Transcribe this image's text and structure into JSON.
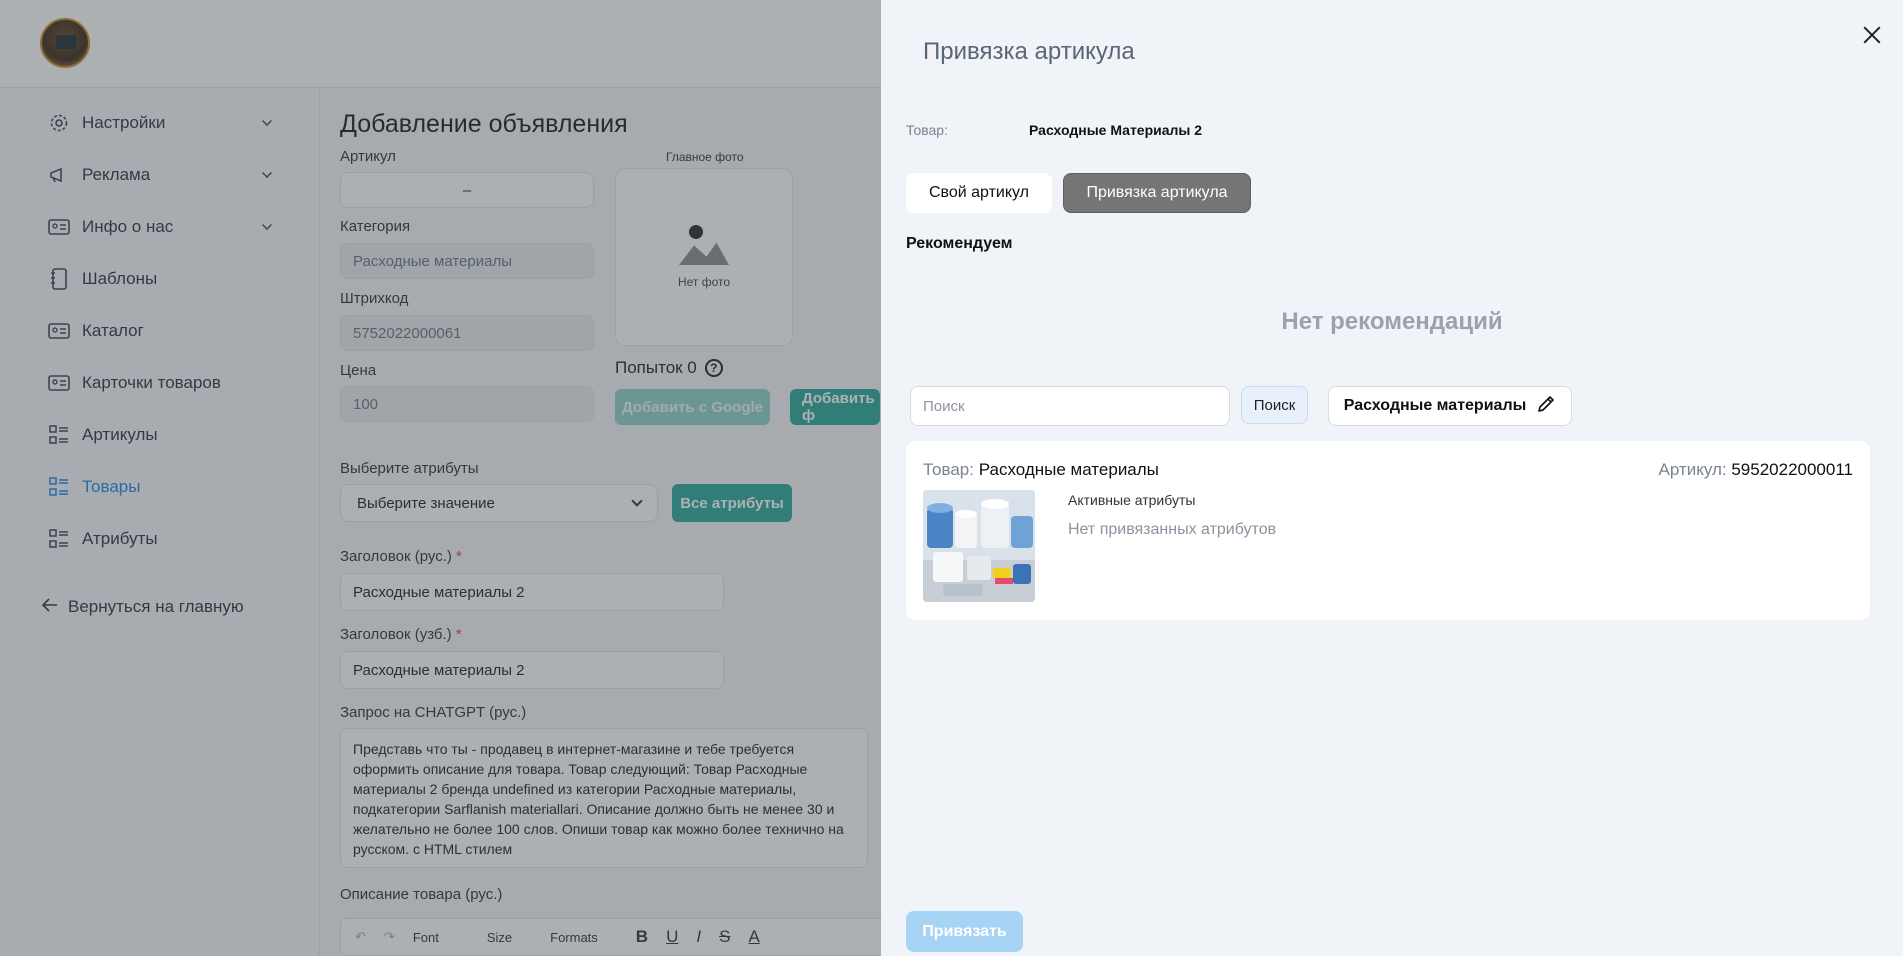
{
  "sidebar": {
    "items": [
      {
        "label": "Настройки",
        "icon": "gear-icon"
      },
      {
        "label": "Реклама",
        "icon": "megaphone-icon"
      },
      {
        "label": "Инфо о нас",
        "icon": "id-card-icon"
      },
      {
        "label": "Шаблоны",
        "icon": "notebook-icon"
      },
      {
        "label": "Каталог",
        "icon": "id-card-icon"
      },
      {
        "label": "Карточки товаров",
        "icon": "id-card-icon"
      },
      {
        "label": "Артикулы",
        "icon": "list-icon"
      },
      {
        "label": "Товары",
        "icon": "list-icon",
        "active": true
      },
      {
        "label": "Атрибуты",
        "icon": "list-icon"
      }
    ],
    "back_label": "Вернуться на главную"
  },
  "form": {
    "title": "Добавление объявления",
    "article_label": "Артикул",
    "article_value": "–",
    "main_photo_label": "Главное фото",
    "no_photo": "Нет фото",
    "category_label": "Категория",
    "category_value": "Расходные материалы",
    "barcode_label": "Штрихкод",
    "barcode_value": "5752022000061",
    "price_label": "Цена",
    "price_value": "100",
    "tries_label": "Попыток 0",
    "add_google": "Добавить с Google",
    "add_file": "Добавить ф",
    "attributes_label": "Выберите атрибуты",
    "attributes_placeholder": "Выберите значение",
    "all_attributes": "Все атрибуты",
    "title_ru_label": "Заголовок (рус.)",
    "title_ru_value": "Расходные материалы 2",
    "title_uz_label": "Заголовок (узб.)",
    "title_uz_value": "Расходные материалы 2",
    "gpt_label": "Запрос на CHATGPT (рус.)",
    "gpt_text": "Представь что ты - продавец в интернет-магазине и тебе требуется оформить описание для товара. Товар следующий: Товар Расходные материалы 2 бренда undefined из категории Расходные материалы, подкатегории Sarflanish materiallari. Описание должно быть не менее 30 и желательно не более 100 слов. Опиши товар как можно более технично на русском. с HTML стилем",
    "desc_label": "Описание товара (рус.)",
    "editor": {
      "font": "Font",
      "size": "Size",
      "formats": "Formats"
    }
  },
  "drawer": {
    "title": "Привязка артикула",
    "product_label": "Товар:",
    "product_value": "Расходные Материалы 2",
    "tab_own": "Свой артикул",
    "tab_bind": "Привязка артикула",
    "recommend_title": "Рекомендуем",
    "no_recommendations": "Нет рекомендаций",
    "search_placeholder": "Поиск",
    "search_button": "Поиск",
    "category_chip": "Расходные материалы",
    "card": {
      "product_key": "Товар:",
      "product_value": "Расходные материалы",
      "article_key": "Артикул:",
      "article_value": "5952022000011",
      "active_attrs": "Активные атрибуты",
      "no_attrs": "Нет привязанных атрибутов"
    },
    "bind_button": "Привязать"
  },
  "colors": {
    "accent_teal": "#2aa99b",
    "active_blue": "#1e88e5",
    "tab_active_gray": "#757575",
    "bind_button_disabled": "#a7d3f5"
  }
}
